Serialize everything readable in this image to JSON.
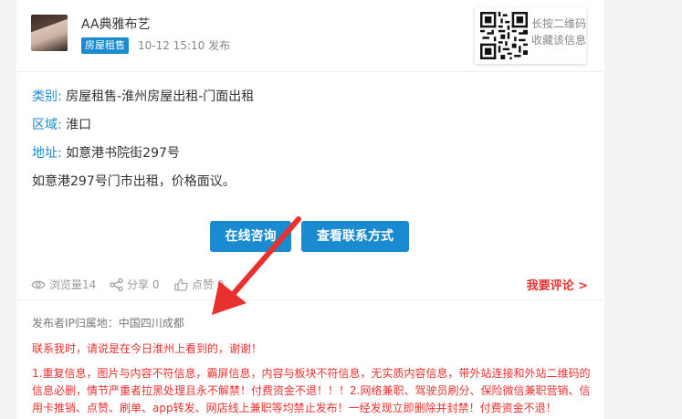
{
  "header": {
    "author": "AA典雅布艺",
    "tag": "房屋租售",
    "time": "10-12 15:10 发布",
    "qr_line1": "长按二维码",
    "qr_line2": "收藏该信息"
  },
  "info": {
    "category_label": "类别:",
    "category_value": "房屋租售-淮州房屋出租-门面出租",
    "region_label": "区域:",
    "region_value": "淮口",
    "address_label": "地址:",
    "address_value": "如意港书院街297号",
    "description": "如意港297号门市出租，价格面议。"
  },
  "buttons": {
    "consult": "在线咨询",
    "contact": "查看联系方式"
  },
  "stats": {
    "views": "浏览量14",
    "shares": "分享 0",
    "likes": "点赞 0",
    "comment_link": "我要评论 >"
  },
  "footer": {
    "ip": "发布者IP归属地：中国四川成都",
    "notice": "联系我时，请说是在今日淮州上看到的，谢谢！",
    "rules": "1.重复信息，图片与内容不符信息，霸屏信息，内容与板块不符信息，无实质内容信息，带外站连接和外站二维码的信息必删，情节严重者拉黑处理且永不解禁！付费资金不退！！！2.网络兼职、驾驶员刷分、保险微信兼职营销、信用卡推销、点赞、刷单、app转发、网店线上兼职等均禁止发布！一经发现立即删除并封禁！付费资金不退！"
  },
  "colors": {
    "accent": "#1a8bd1",
    "warning": "#e8312f"
  }
}
